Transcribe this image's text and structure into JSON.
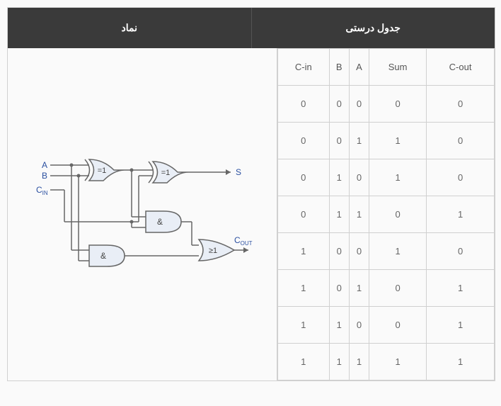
{
  "headers": {
    "symbol": "نماد",
    "truth": "جدول درستی"
  },
  "diagram": {
    "inputs": {
      "a": "A",
      "b": "B",
      "cin": "C",
      "cin_sub": "IN"
    },
    "outputs": {
      "s": "S",
      "cout": "C",
      "cout_sub": "OUT"
    },
    "gates": {
      "xor1": "=1",
      "xor2": "=1",
      "and1": "&",
      "and2": "&",
      "or": "≥1"
    }
  },
  "truth_table": {
    "columns": [
      "C-in",
      "B",
      "A",
      "Sum",
      "C-out"
    ],
    "rows": [
      [
        0,
        0,
        0,
        0,
        0
      ],
      [
        0,
        0,
        1,
        1,
        0
      ],
      [
        0,
        1,
        0,
        1,
        0
      ],
      [
        0,
        1,
        1,
        0,
        1
      ],
      [
        1,
        0,
        0,
        1,
        0
      ],
      [
        1,
        0,
        1,
        0,
        1
      ],
      [
        1,
        1,
        0,
        0,
        1
      ],
      [
        1,
        1,
        1,
        1,
        1
      ]
    ]
  }
}
